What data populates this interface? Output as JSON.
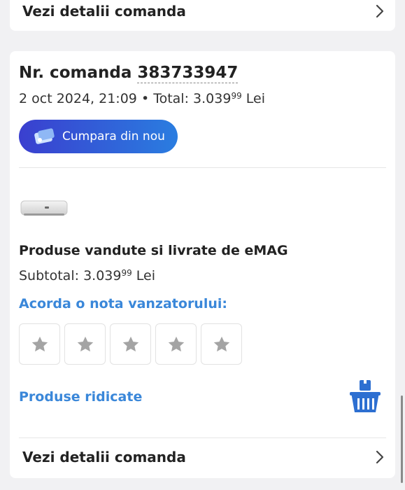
{
  "top_card": {
    "details_label": "Vezi detalii comanda"
  },
  "order": {
    "number_label": "Nr. comanda",
    "number": "383733947",
    "date": "2 oct 2024, 21:09",
    "separator": "•",
    "total_label": "Total:",
    "total_int": "3.039",
    "total_dec": "99",
    "currency": "Lei",
    "rebuy_label": "Cumpara din nou",
    "seller_text": "Produse vandute si livrate de eMAG",
    "subtotal_label": "Subtotal:",
    "subtotal_int": "3.039",
    "subtotal_dec": "99",
    "rate_label": "Acorda o nota vanzatorului:",
    "rating": {
      "stars_total": 5,
      "stars_selected": 0
    },
    "picked_label": "Produse ridicate",
    "details_label": "Vezi detalii comanda"
  },
  "colors": {
    "accent_blue": "#3a87d9",
    "button_start": "#3a3fcf",
    "button_end": "#2a7de0"
  }
}
